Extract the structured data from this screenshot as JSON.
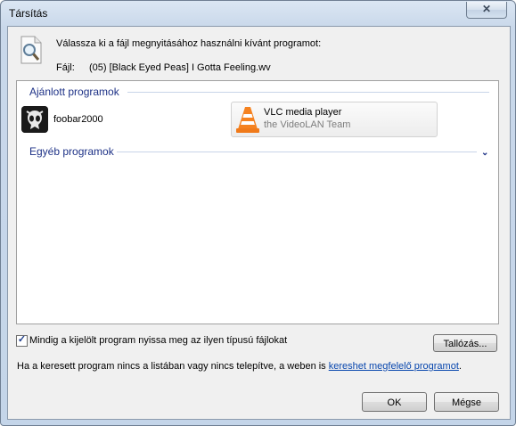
{
  "window": {
    "title": "Társítás",
    "close_glyph": "✕"
  },
  "prompt": "Válassza ki a fájl megnyitásához használni kívánt programot:",
  "file": {
    "label": "Fájl:",
    "name": "(05) [Black Eyed Peas] I Gotta Feeling.wv",
    "icon": "document-magnifier-icon"
  },
  "recommended": {
    "header": "Ajánlott programok",
    "items": [
      {
        "name": "foobar2000",
        "icon": "foobar2000-icon"
      },
      {
        "name": "VLC media player",
        "publisher": "the VideoLAN Team",
        "icon": "vlc-cone-icon",
        "selected": true
      }
    ]
  },
  "other": {
    "header": "Egyéb programok",
    "expand_glyph": "⌄"
  },
  "always_use": {
    "label": "Mindig a kijelölt program nyissa meg az ilyen típusú fájlokat",
    "checked": true
  },
  "browse_label": "Tallózás...",
  "info": {
    "text_before": "Ha a keresett program nincs a listában vagy nincs telepítve, a weben is ",
    "link": "kereshet megfelelő programot",
    "text_after": "."
  },
  "buttons": {
    "ok": "OK",
    "cancel": "Mégse"
  },
  "colors": {
    "accent": "#1e3287",
    "link": "#0645ad",
    "titlebar": "#c9d8ea"
  }
}
